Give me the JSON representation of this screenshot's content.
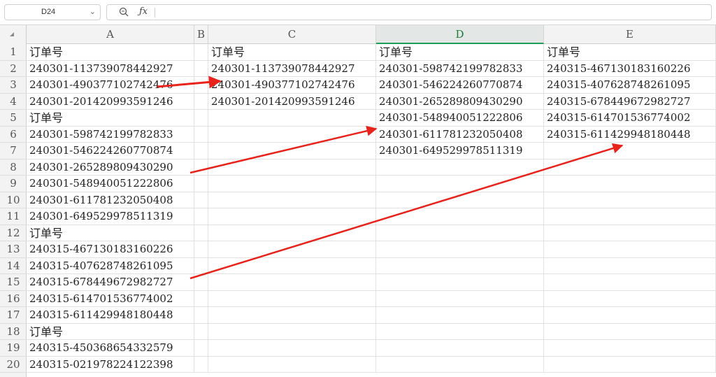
{
  "formula_bar": {
    "name_box": "D24",
    "formula": ""
  },
  "columns": [
    "A",
    "B",
    "C",
    "D",
    "E"
  ],
  "active_column": "D",
  "rows": [
    "1",
    "2",
    "3",
    "4",
    "5",
    "6",
    "7",
    "8",
    "9",
    "10",
    "11",
    "12",
    "13",
    "14",
    "15",
    "16",
    "17",
    "18",
    "19",
    "20"
  ],
  "col_a": [
    "订单号",
    "240301-113739078442927",
    "240301-490377102742476",
    "240301-201420993591246",
    "订单号",
    "240301-598742199782833",
    "240301-546224260770874",
    "240301-265289809430290",
    "240301-548940051222806",
    "240301-611781232050408",
    "240301-649529978511319",
    "订单号",
    "240315-467130183160226",
    "240315-407628748261095",
    "240315-678449672982727",
    "240315-614701536774002",
    "240315-611429948180448",
    "订单号",
    "240315-450368654332579",
    "240315-021978224122398"
  ],
  "col_c": [
    "订单号",
    "240301-113739078442927",
    "240301-490377102742476",
    "240301-201420993591246"
  ],
  "col_d": [
    "订单号",
    "240301-598742199782833",
    "240301-546224260770874",
    "240301-265289809430290",
    "240301-548940051222806",
    "240301-611781232050408",
    "240301-649529978511319"
  ],
  "col_e": [
    "订单号",
    "240315-467130183160226",
    "240315-407628748261095",
    "240315-678449672982727",
    "240315-614701536774002",
    "240315-611429948180448"
  ],
  "annotation_color": "#e8231c"
}
